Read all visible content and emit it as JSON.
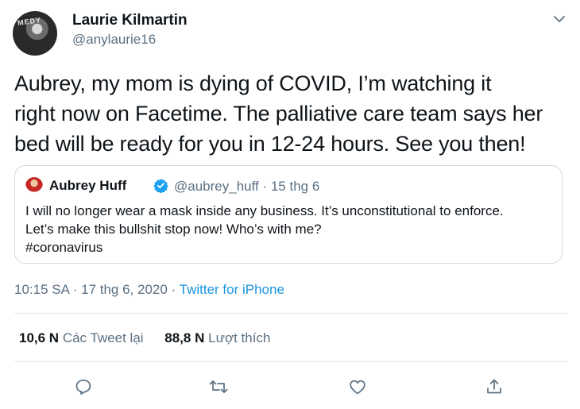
{
  "tweet": {
    "author": {
      "display_name": "Laurie Kilmartin",
      "handle": "@anylaurie16",
      "avatar_text": "MEDY"
    },
    "text_lines": [
      "Aubrey, my mom is dying of COVID, I’m watching it",
      "right now on Facetime. The palliative care team says her",
      "bed will be ready for you in 12-24 hours. See you then!"
    ],
    "quoted": {
      "display_name": "Aubrey Huff",
      "handle_and_date": "@aubrey_huff · 15 thg 6",
      "verified": true,
      "text_lines": [
        "I will no longer wear a mask inside any business. It’s unconstitutional to enforce.",
        "Let’s make this bullshit stop now! Who’s with me?",
        "#coronavirus"
      ]
    },
    "meta": {
      "timestamp": "10:15 SA · 17 thg 6, 2020 · ",
      "source": "Twitter for iPhone"
    },
    "stats": {
      "retweets_count": "10,6 N",
      "retweets_label": "Các Tweet lại",
      "likes_count": "88,8 N",
      "likes_label": "Lượt thích"
    },
    "actions": [
      "reply-icon",
      "retweet-icon",
      "like-icon",
      "share-icon"
    ],
    "colors": {
      "link": "#1b95e0",
      "secondary_text": "#5b7083",
      "verified": "#1da1f2",
      "border": "#cfd9de"
    }
  }
}
